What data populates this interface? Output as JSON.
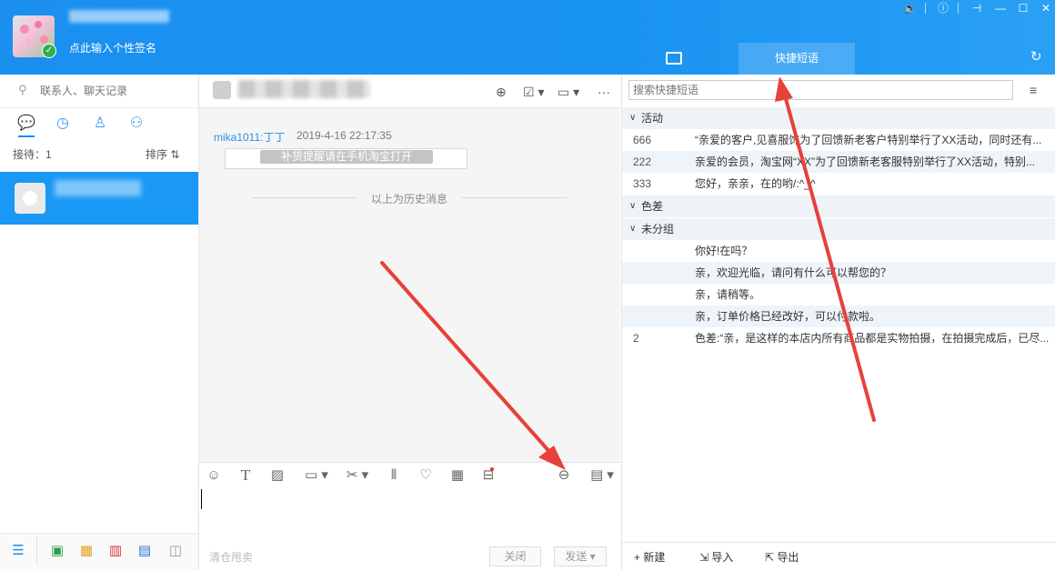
{
  "header": {
    "signature": "点此输入个性签名",
    "tabs": [
      "",
      "快捷短语"
    ]
  },
  "sidebar": {
    "search_placeholder": "联系人、聊天记录",
    "reception_label": "接待：1",
    "sort_label": "排序 ⇅"
  },
  "chat": {
    "message": {
      "sender": "mika1011:丁丁",
      "time": "2019-4-16 22:17:35",
      "card_text": "补货提醒请在手机淘宝打开"
    },
    "history_divider": "以上为历史消息",
    "clear_hint": "清仓甩卖",
    "close_label": "关闭",
    "send_label": "发送 ▾"
  },
  "quick_phrases": {
    "search_placeholder": "搜索快捷短语",
    "groups": [
      {
        "name": "活动",
        "items": [
          {
            "code": "666",
            "text": "“亲爱的客户,见喜服饰为了回馈新老客户特别举行了XX活动，同时还有..."
          },
          {
            "code": "222",
            "text": "亲爱的会员，淘宝网“XX”为了回馈新老客服特别举行了XX活动，特别..."
          },
          {
            "code": "333",
            "text": "您好，亲亲，在的哟/:^_^"
          }
        ]
      },
      {
        "name": "色差",
        "items": []
      },
      {
        "name": "未分组",
        "items": [
          {
            "code": "",
            "text": "你好!在吗？"
          },
          {
            "code": "",
            "text": "亲，欢迎光临，请问有什么可以帮您的？"
          },
          {
            "code": "",
            "text": "亲，请稍等。"
          },
          {
            "code": "",
            "text": "亲，订单价格已经改好，可以付款啦。"
          },
          {
            "code": "2",
            "text": "色差:“亲，是这样的本店内所有商品都是实物拍摄，在拍摄完成后，已尽..."
          }
        ]
      }
    ],
    "footer": {
      "new_label": "+ 新建",
      "import_label": "导入",
      "export_label": "导出"
    }
  },
  "colors": {
    "brand_blue": "#1a8ff0",
    "arrow_red": "#e8403a"
  },
  "icons": [
    "search-icon",
    "chat-bubble-icon",
    "clock-icon",
    "person-icon",
    "group-icon",
    "menu-icon",
    "refresh-icon",
    "emoji-icon",
    "font-icon",
    "image-icon",
    "folder-icon",
    "scissors-icon",
    "shake-icon",
    "heart-icon",
    "calculator-icon",
    "coupon-icon",
    "transfer-icon",
    "history-icon"
  ]
}
